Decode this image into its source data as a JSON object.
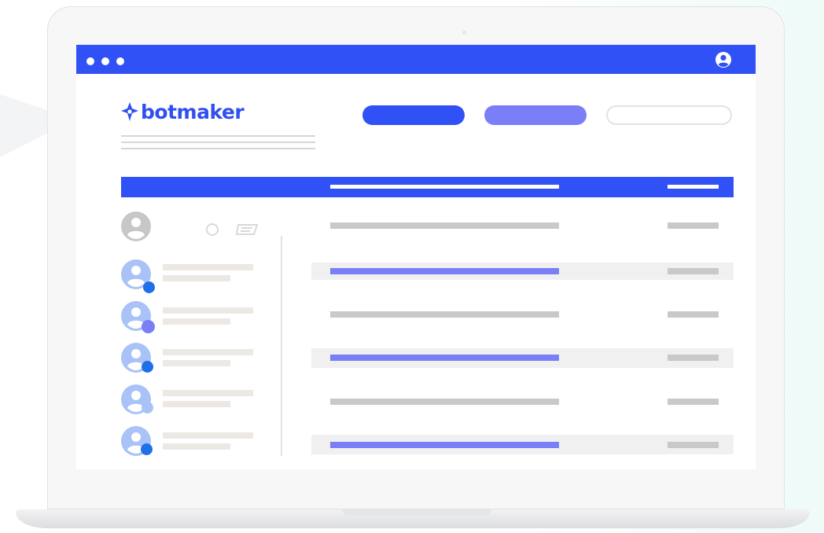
{
  "brand": {
    "name": "botmaker",
    "color": "#2f4ff0"
  },
  "colors": {
    "primary": "#3051f5",
    "secondary": "#7a7ef7",
    "muted": "#c9c9c9",
    "avatar": "#a9c2f7",
    "status_blue": "#1f6fe8",
    "status_purple": "#7a7ef7",
    "status_light": "#a9c2f7"
  },
  "window": {
    "controls": [
      "dot",
      "dot",
      "dot"
    ],
    "account_icon": "user-circle-icon"
  },
  "header": {
    "buttons": [
      {
        "style": "filled-primary"
      },
      {
        "style": "filled-secondary"
      },
      {
        "style": "outline"
      }
    ]
  },
  "contacts": [
    {
      "status": "blue"
    },
    {
      "status": "purple"
    },
    {
      "status": "blue"
    },
    {
      "status": "light"
    },
    {
      "status": "blue"
    }
  ],
  "table": {
    "rows": [
      {
        "highlighted": false
      },
      {
        "highlighted": true
      },
      {
        "highlighted": false
      },
      {
        "highlighted": true
      },
      {
        "highlighted": false
      },
      {
        "highlighted": true
      }
    ]
  }
}
